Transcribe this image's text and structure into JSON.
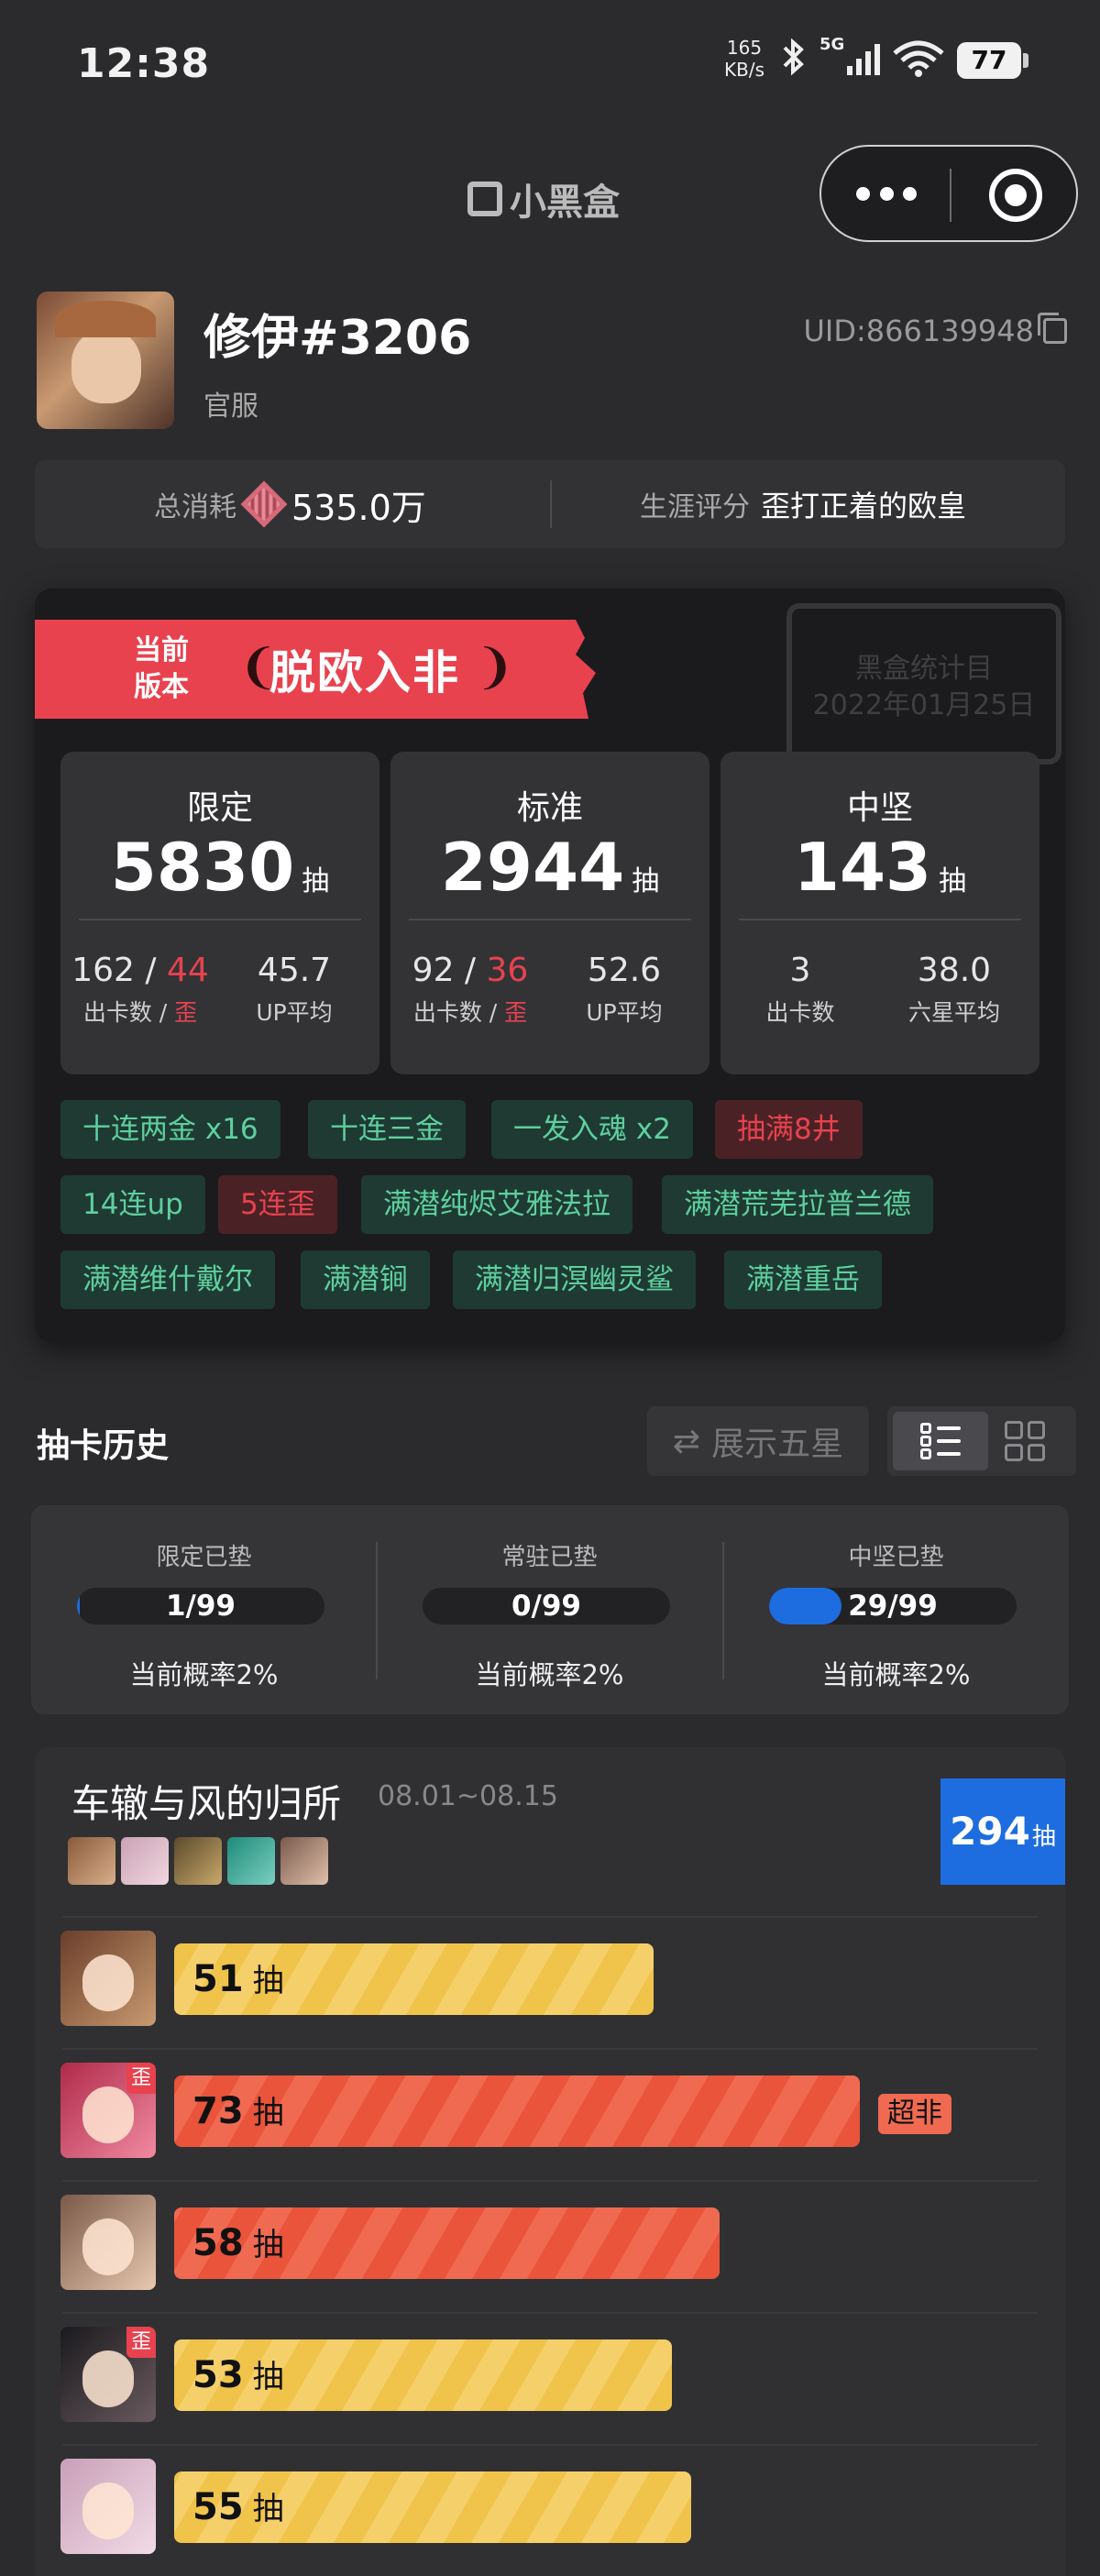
{
  "status_bar": {
    "time": "12:38",
    "speed_value": "165",
    "speed_unit": "KB/s",
    "network": "5G",
    "battery": "77"
  },
  "nav": {
    "brand": "小黑盒"
  },
  "profile": {
    "username": "修伊#3206",
    "server": "官服",
    "uid": "UID:866139948"
  },
  "summary": {
    "spend_label": "总消耗",
    "spend_value": "535.0万",
    "rating_label": "生涯评分",
    "rating_value": "歪打正着的欧皇"
  },
  "stats_card": {
    "ribbon_label_line1": "当前",
    "ribbon_label_line2": "版本",
    "ribbon_title": "脱欧入非",
    "stamp_line1": "黑盒统计目",
    "stamp_line2": "2022年01月25日",
    "pools": [
      {
        "name": "限定",
        "count": "5830",
        "unit": "抽",
        "pulls": "162",
        "off": "44",
        "avg": "45.7",
        "pulls_label": "出卡数",
        "off_label": "歪",
        "avg_label": "UP平均"
      },
      {
        "name": "标准",
        "count": "2944",
        "unit": "抽",
        "pulls": "92",
        "off": "36",
        "avg": "52.6",
        "pulls_label": "出卡数",
        "off_label": "歪",
        "avg_label": "UP平均"
      },
      {
        "name": "中坚",
        "count": "143",
        "unit": "抽",
        "pulls": "3",
        "avg": "38.0",
        "pulls_label": "出卡数",
        "avg_label": "六星平均"
      }
    ],
    "tags": [
      {
        "text": "十连两金  x16",
        "style": "green"
      },
      {
        "text": "十连三金",
        "style": "green"
      },
      {
        "text": "一发入魂 x2",
        "style": "green"
      },
      {
        "text": "抽满8井",
        "style": "red"
      },
      {
        "text": "14连up",
        "style": "green"
      },
      {
        "text": "5连歪",
        "style": "red"
      },
      {
        "text": "满潜纯烬艾雅法拉",
        "style": "green"
      },
      {
        "text": "满潜荒芜拉普兰德",
        "style": "green"
      },
      {
        "text": "满潜维什戴尔",
        "style": "green"
      },
      {
        "text": "满潜锏",
        "style": "green"
      },
      {
        "text": "满潜归溟幽灵鲨",
        "style": "green"
      },
      {
        "text": "满潜重岳",
        "style": "green"
      }
    ]
  },
  "history": {
    "title": "抽卡历史",
    "show_five_star": "展示五星"
  },
  "pity": [
    {
      "label": "限定已垫",
      "value": "1/99",
      "fraction": 0.0101,
      "prob": "当前概率2%"
    },
    {
      "label": "常驻已垫",
      "value": "0/99",
      "fraction": 0,
      "prob": "当前概率2%"
    },
    {
      "label": "中坚已垫",
      "value": "29/99",
      "fraction": 0.293,
      "prob": "当前概率2%"
    }
  ],
  "banner": {
    "title": "车辙与风的归所",
    "dates": "08.01~08.15",
    "total": "294",
    "total_unit": "抽",
    "pulls": [
      {
        "count": "51",
        "unit": "抽",
        "color": "yellow",
        "off_banner": false
      },
      {
        "count": "73",
        "unit": "抽",
        "color": "orange",
        "off_banner": true,
        "off_label": "歪",
        "flag": "超非"
      },
      {
        "count": "58",
        "unit": "抽",
        "color": "orange",
        "off_banner": false
      },
      {
        "count": "53",
        "unit": "抽",
        "color": "yellow",
        "off_banner": true,
        "off_label": "歪"
      },
      {
        "count": "55",
        "unit": "抽",
        "color": "yellow",
        "off_banner": false
      }
    ]
  },
  "colors": {
    "accent_red": "#e8424f",
    "accent_blue": "#1d6de0",
    "tag_green": "#5fcf9f",
    "bar_yellow": "#f0c34a",
    "bar_orange": "#e9543b"
  },
  "icons": {
    "bluetooth": "bluetooth-icon",
    "signal": "signal-icon",
    "wifi": "wifi-icon",
    "copy": "copy-icon",
    "swap": "swap-icon",
    "list_view": "list-view-icon",
    "grid_view": "grid-view-icon"
  }
}
